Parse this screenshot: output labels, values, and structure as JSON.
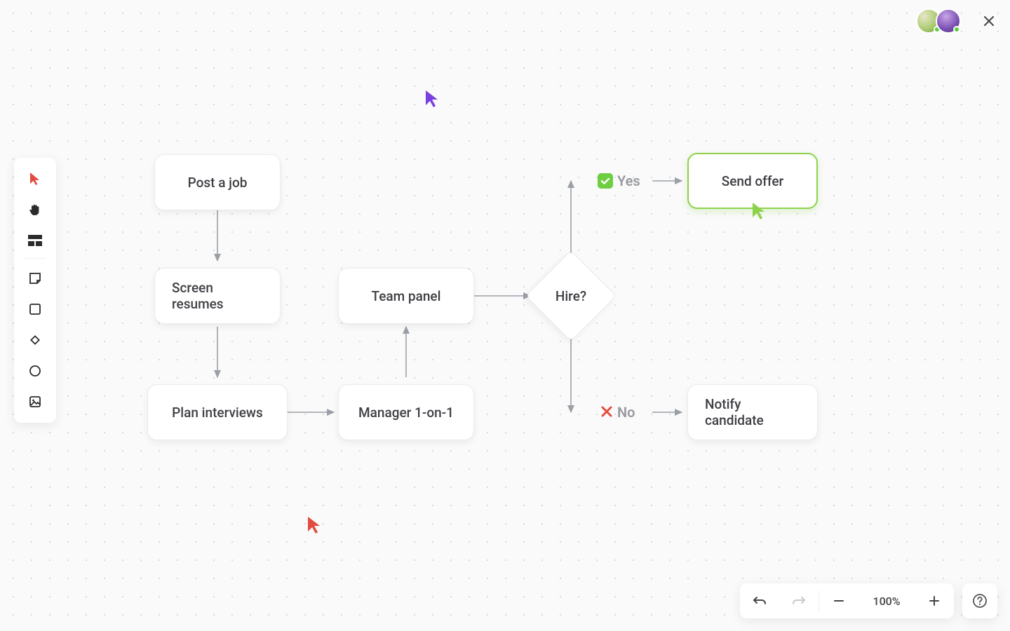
{
  "topbar": {
    "collaborators": [
      {
        "name": "collaborator-1",
        "online": true
      },
      {
        "name": "collaborator-2",
        "online": true
      }
    ]
  },
  "toolbar": {
    "tools": [
      {
        "name": "pointer-tool"
      },
      {
        "name": "hand-tool"
      },
      {
        "name": "section-tool"
      },
      {
        "name": "sticky-note-tool"
      },
      {
        "name": "rectangle-tool"
      },
      {
        "name": "diamond-tool"
      },
      {
        "name": "ellipse-tool"
      },
      {
        "name": "image-tool"
      }
    ]
  },
  "diagram": {
    "nodes": {
      "post_job": {
        "label": "Post a job"
      },
      "screen_resumes": {
        "label": "Screen resumes"
      },
      "plan_interviews": {
        "label": "Plan interviews"
      },
      "manager_1on1": {
        "label": "Manager 1-on-1"
      },
      "team_panel": {
        "label": "Team panel"
      },
      "hire_decision": {
        "label": "Hire?"
      },
      "send_offer": {
        "label": "Send offer",
        "selected": true
      },
      "notify_candidate": {
        "label": "Notify candidate"
      }
    },
    "decision": {
      "yes_label": "Yes",
      "no_label": "No"
    }
  },
  "cursors": {
    "purple": {
      "color": "#7a3fe0"
    },
    "red": {
      "color": "#e24b3f"
    },
    "green": {
      "color": "#8dd24a"
    }
  },
  "footer": {
    "zoom_level": "100%"
  },
  "colors": {
    "accent_green": "#8dd24a",
    "check_green": "#6fce3f",
    "cross_red": "#e84a3a",
    "arrow": "#9aa0a6"
  }
}
